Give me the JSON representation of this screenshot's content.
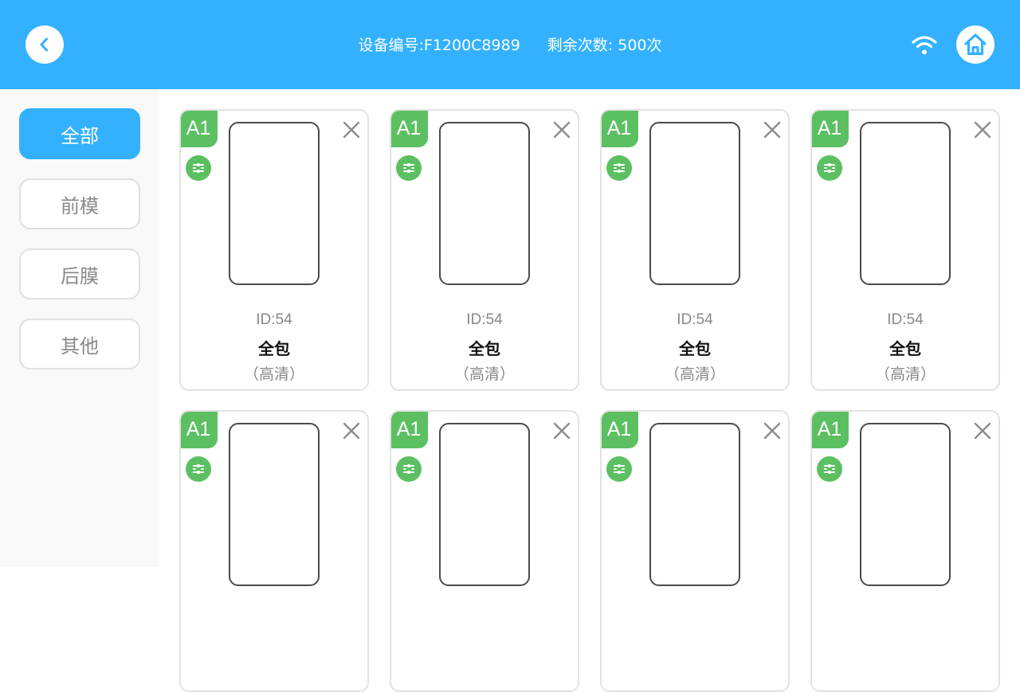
{
  "header": {
    "device_label": "设备编号:F1200C8989",
    "remaining_label": "剩余次数: 500次"
  },
  "sidebar": {
    "items": [
      {
        "label": "全部",
        "active": true
      },
      {
        "label": "前模",
        "active": false
      },
      {
        "label": "后膜",
        "active": false
      },
      {
        "label": "其他",
        "active": false
      }
    ]
  },
  "cards": [
    {
      "badge": "A1",
      "id": "ID:54",
      "name": "全包",
      "subtitle": "（高清）"
    },
    {
      "badge": "A1",
      "id": "ID:54",
      "name": "全包",
      "subtitle": "（高清）"
    },
    {
      "badge": "A1",
      "id": "ID:54",
      "name": "全包",
      "subtitle": "（高清）"
    },
    {
      "badge": "A1",
      "id": "ID:54",
      "name": "全包",
      "subtitle": "（高清）"
    },
    {
      "badge": "A1",
      "id": "",
      "name": "",
      "subtitle": ""
    },
    {
      "badge": "A1",
      "id": "",
      "name": "",
      "subtitle": ""
    },
    {
      "badge": "A1",
      "id": "",
      "name": "",
      "subtitle": ""
    },
    {
      "badge": "A1",
      "id": "",
      "name": "",
      "subtitle": ""
    }
  ],
  "colors": {
    "primary": "#33b1ff",
    "badge_green": "#5cc062"
  },
  "icons": {
    "back": "chevron-left-icon",
    "wifi": "wifi-icon",
    "home": "home-icon",
    "card_filter": "filter-icon",
    "card_close": "close-icon"
  }
}
